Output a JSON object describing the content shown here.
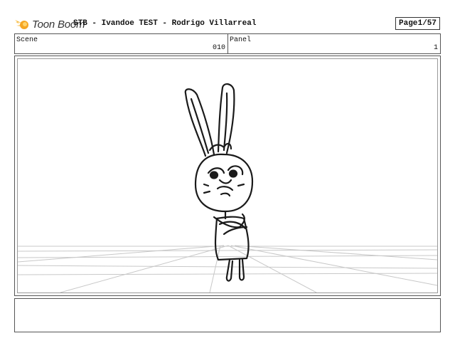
{
  "header": {
    "logo_text": "Toon Boom",
    "title": "STB - Ivandoe TEST - Rodrigo Villarreal",
    "page_label": "Page",
    "page_value": "1/57"
  },
  "info": {
    "scene_label": "Scene",
    "scene_value": "010",
    "panel_label": "Panel",
    "panel_value": "1"
  },
  "colors": {
    "logo_accent": "#f5a623",
    "border": "#555555"
  },
  "icons": {
    "logo": "toon-boom-comet-icon"
  }
}
